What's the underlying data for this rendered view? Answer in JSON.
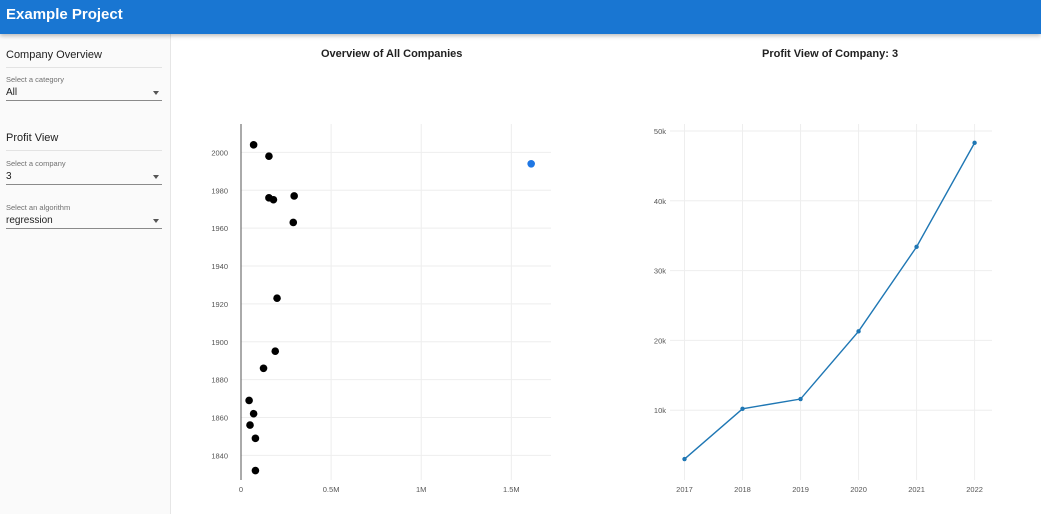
{
  "app": {
    "title": "Example Project"
  },
  "sidebar": {
    "overview_section": {
      "title": "Company Overview",
      "category": {
        "label": "Select a category",
        "value": "All"
      }
    },
    "profit_section": {
      "title": "Profit View",
      "company": {
        "label": "Select a company",
        "value": "3"
      },
      "algorithm": {
        "label": "Select an algorithm",
        "value": "regression"
      }
    }
  },
  "colors": {
    "appbar": "#1976d2",
    "scatter_point": "#000000",
    "scatter_selected": "#1f77e4",
    "line": "#1f77b4"
  },
  "chart_data": [
    {
      "type": "scatter",
      "title": "Overview of All Companies",
      "xlabel": "",
      "ylabel": "",
      "xlim": [
        0,
        1720000
      ],
      "ylim": [
        1827,
        2015
      ],
      "xticks": [
        0,
        500000,
        1000000,
        1500000
      ],
      "xtick_labels": [
        "0",
        "0.5M",
        "1M",
        "1.5M"
      ],
      "yticks": [
        1840,
        1860,
        1880,
        1900,
        1920,
        1940,
        1960,
        1980,
        2000
      ],
      "ytick_labels": [
        "1840",
        "1860",
        "1880",
        "1900",
        "1920",
        "1940",
        "1960",
        "1980",
        "2000"
      ],
      "grid": true,
      "series": [
        {
          "points": [
            {
              "x": 70000,
              "y": 2004
            },
            {
              "x": 155000,
              "y": 1998
            },
            {
              "x": 295000,
              "y": 1977
            },
            {
              "x": 155000,
              "y": 1976
            },
            {
              "x": 180000,
              "y": 1975
            },
            {
              "x": 290000,
              "y": 1963
            },
            {
              "x": 200000,
              "y": 1923
            },
            {
              "x": 190000,
              "y": 1895
            },
            {
              "x": 125000,
              "y": 1886
            },
            {
              "x": 45000,
              "y": 1869
            },
            {
              "x": 70000,
              "y": 1862
            },
            {
              "x": 50000,
              "y": 1856
            },
            {
              "x": 80000,
              "y": 1849
            },
            {
              "x": 80000,
              "y": 1832
            }
          ]
        },
        {
          "points": [
            {
              "x": 1610000,
              "y": 1994
            }
          ]
        }
      ]
    },
    {
      "type": "line",
      "title": "Profit View of Company: 3",
      "xlabel": "",
      "ylabel": "",
      "x": [
        2017,
        2018,
        2019,
        2020,
        2021,
        2022
      ],
      "values": [
        3000,
        10200,
        11600,
        21300,
        33400,
        48300
      ],
      "xlim": [
        2016.75,
        2022.3
      ],
      "ylim": [
        0,
        51000
      ],
      "yticks": [
        10000,
        20000,
        30000,
        40000,
        50000
      ],
      "ytick_labels": [
        "10k",
        "20k",
        "30k",
        "40k",
        "50k"
      ],
      "xtick_labels": [
        "2017",
        "2018",
        "2019",
        "2020",
        "2021",
        "2022"
      ],
      "grid": true
    }
  ]
}
